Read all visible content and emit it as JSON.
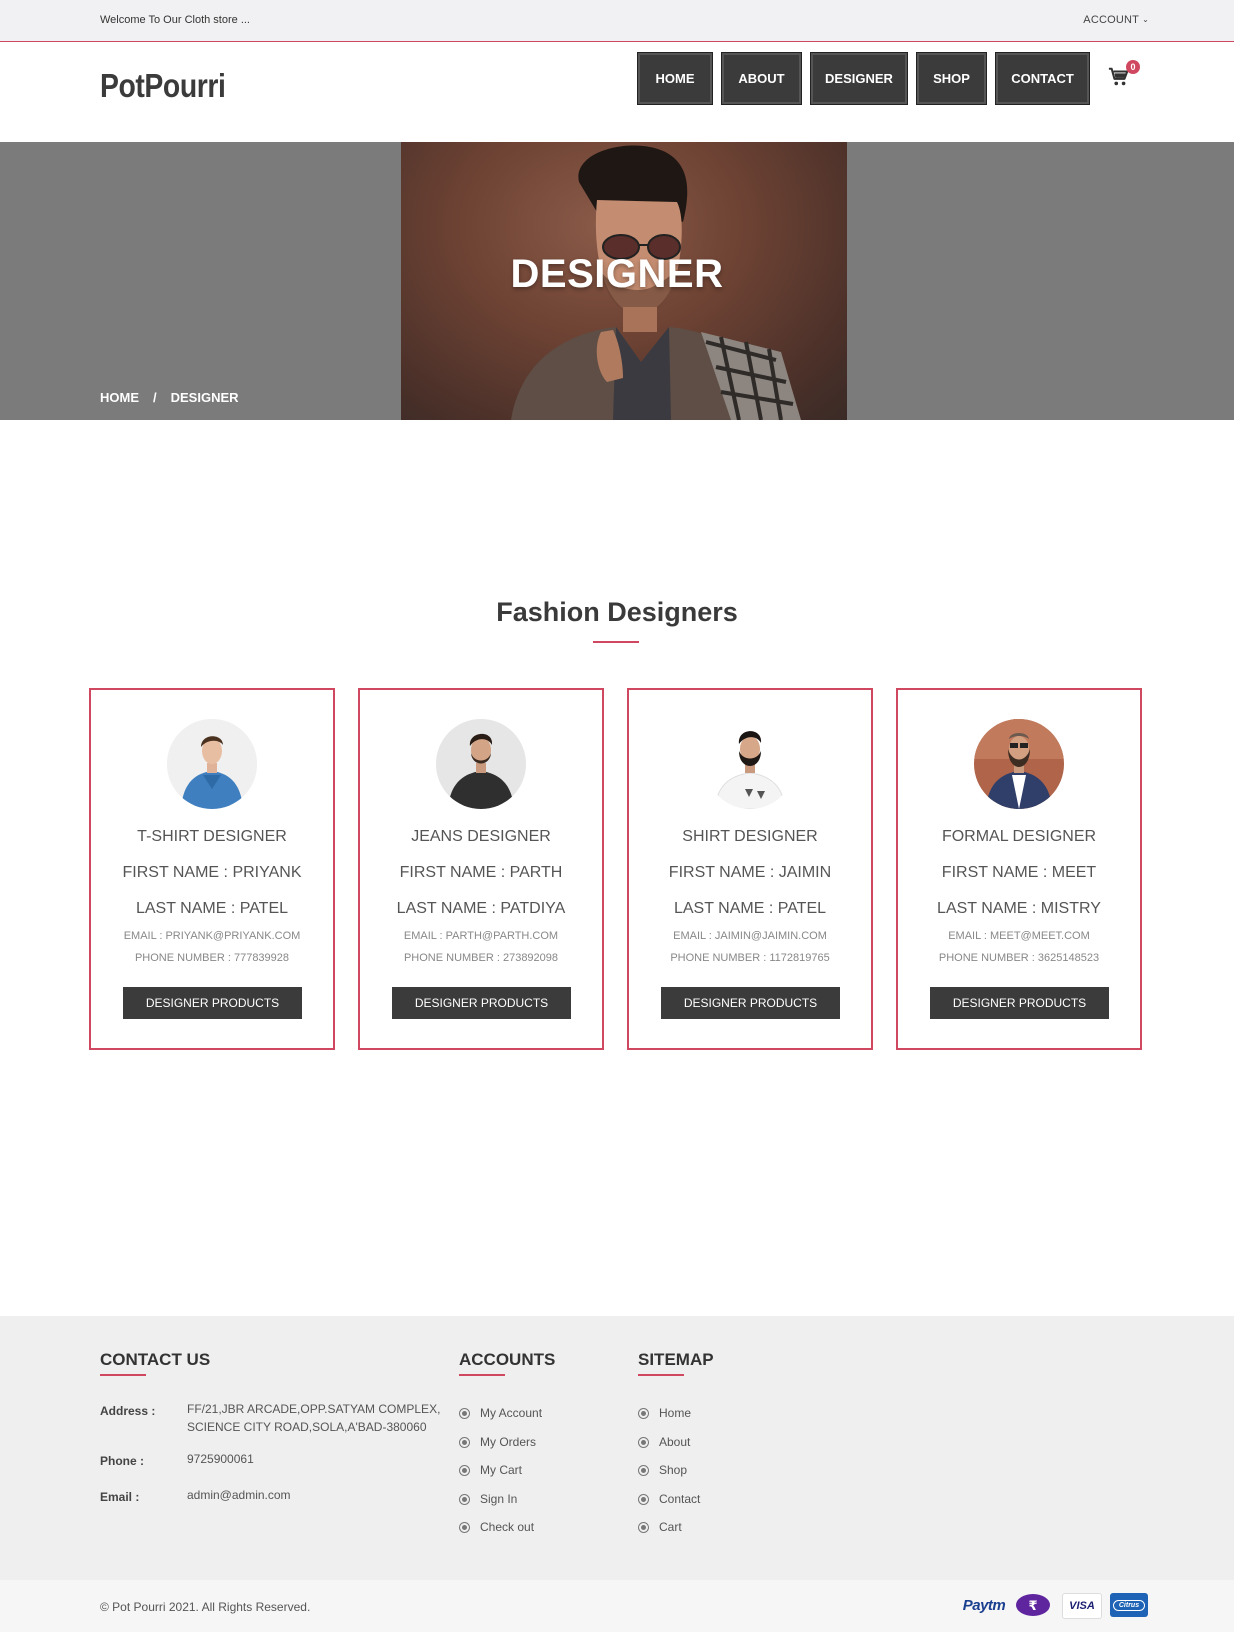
{
  "topbar": {
    "welcome": "Welcome To Our Cloth store ...",
    "account": "ACCOUNT"
  },
  "header": {
    "logo": "PotPourri",
    "nav": [
      {
        "label": "HOME"
      },
      {
        "label": "ABOUT"
      },
      {
        "label": "DESIGNER"
      },
      {
        "label": "SHOP"
      },
      {
        "label": "CONTACT"
      }
    ],
    "cart_count": "0"
  },
  "banner": {
    "title": "DESIGNER",
    "breadcrumb": {
      "home": "HOME",
      "separator": "/",
      "current": "DESIGNER"
    }
  },
  "section": {
    "title": "Fashion Designers"
  },
  "designers": [
    {
      "role": "T-SHIRT DESIGNER",
      "first_name": "FIRST NAME : PRIYANK",
      "last_name": "LAST NAME : PATEL",
      "email": "EMAIL : PRIYANK@PRIYANK.COM",
      "phone": "PHONE NUMBER : 777839928",
      "button": "DESIGNER PRODUCTS"
    },
    {
      "role": "JEANS DESIGNER",
      "first_name": "FIRST NAME : PARTH",
      "last_name": "LAST NAME : PATDIYA",
      "email": "EMAIL : PARTH@PARTH.COM",
      "phone": "PHONE NUMBER : 273892098",
      "button": "DESIGNER PRODUCTS"
    },
    {
      "role": "SHIRT DESIGNER",
      "first_name": "FIRST NAME : JAIMIN",
      "last_name": "LAST NAME : PATEL",
      "email": "EMAIL : JAIMIN@JAIMIN.COM",
      "phone": "PHONE NUMBER : 1172819765",
      "button": "DESIGNER PRODUCTS"
    },
    {
      "role": "FORMAL DESIGNER",
      "first_name": "FIRST NAME : MEET",
      "last_name": "LAST NAME : MISTRY",
      "email": "EMAIL : MEET@MEET.COM",
      "phone": "PHONE NUMBER : 3625148523",
      "button": "DESIGNER PRODUCTS"
    }
  ],
  "footer": {
    "contact": {
      "heading": "CONTACT US",
      "address_label": "Address :",
      "address_line1": "FF/21,JBR ARCADE,OPP.SATYAM COMPLEX,",
      "address_line2": "SCIENCE CITY ROAD,SOLA,A'BAD-380060",
      "phone_label": "Phone :",
      "phone": "9725900061",
      "email_label": "Email :",
      "email": "admin@admin.com"
    },
    "accounts": {
      "heading": "ACCOUNTS",
      "items": [
        "My Account",
        "My Orders",
        "My Cart",
        "Sign In",
        "Check out"
      ]
    },
    "sitemap": {
      "heading": "SITEMAP",
      "items": [
        "Home",
        "About",
        "Shop",
        "Contact",
        "Cart"
      ]
    },
    "copyright": "© Pot Pourri 2021. All Rights Reserved.",
    "payments": [
      {
        "icon": "paytm-icon",
        "text": "Paytm"
      },
      {
        "icon": "phonepe-icon",
        "text": ""
      },
      {
        "icon": "visa-icon",
        "text": "VISA"
      },
      {
        "icon": "citrus-icon",
        "text": "Citrus"
      }
    ]
  },
  "colors": {
    "accent": "#d0485f",
    "dark": "#3b3b3b",
    "banner_gray": "#7b7b7b",
    "footer_bg": "#efefef"
  }
}
